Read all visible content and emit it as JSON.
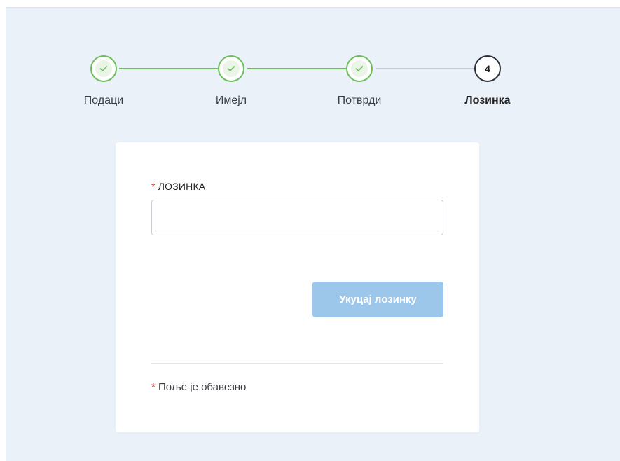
{
  "stepper": {
    "steps": [
      {
        "label": "Подаци",
        "status": "done",
        "icon": "check-icon"
      },
      {
        "label": "Имејл",
        "status": "done",
        "icon": "check-icon"
      },
      {
        "label": "Потврди",
        "status": "done",
        "icon": "check-icon"
      },
      {
        "label": "Лозинка",
        "status": "active",
        "number": "4"
      }
    ]
  },
  "form": {
    "required_mark": "*",
    "password_label": "ЛОЗИНКА",
    "password_value": "",
    "password_placeholder": "",
    "submit_label": "Укуцај лозинку",
    "required_note": "Поље је обавезно"
  },
  "colors": {
    "background": "#ebf1f9",
    "step_done": "#6bbf59",
    "step_pending_line": "#c8ccd4",
    "required": "#e0352b",
    "button": "#9cc6ea"
  }
}
